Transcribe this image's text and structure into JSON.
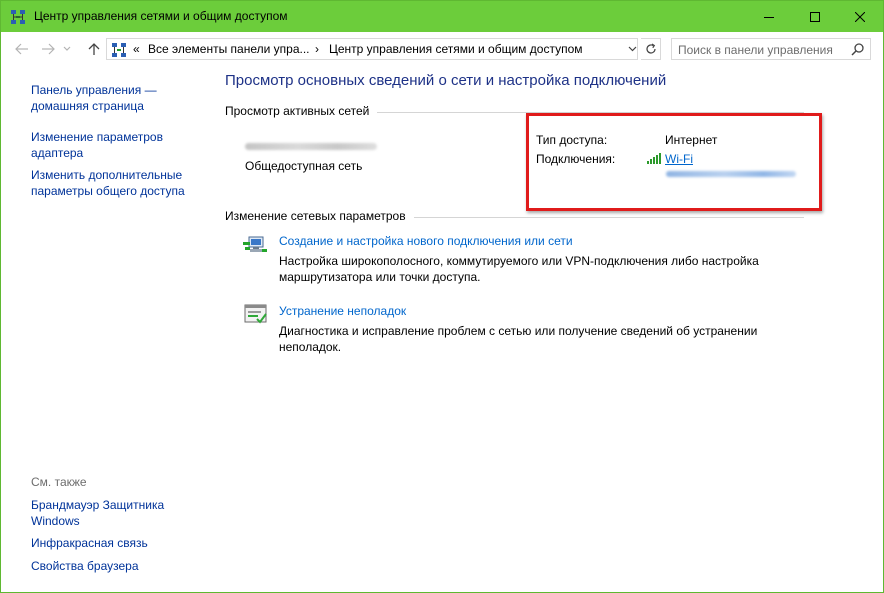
{
  "window": {
    "title": "Центр управления сетями и общим доступом",
    "controls": {
      "minimize": "minimize",
      "maximize": "maximize",
      "close": "close"
    }
  },
  "address": {
    "overflow": "«",
    "crumbs": [
      "Все элементы панели упра...",
      "Центр управления сетями и общим доступом"
    ],
    "separator": "›"
  },
  "search": {
    "placeholder": "Поиск в панели управления"
  },
  "sidebar": {
    "items": [
      {
        "label": "Панель управления — домашняя страница"
      },
      {
        "label": "Изменение параметров адаптера"
      },
      {
        "label": "Изменить дополнительные параметры общего доступа"
      }
    ],
    "see_also": {
      "header": "См. также",
      "items": [
        {
          "label": "Брандмауэр Защитника Windows"
        },
        {
          "label": "Инфракрасная связь"
        },
        {
          "label": "Свойства браузера"
        }
      ]
    }
  },
  "main": {
    "title": "Просмотр основных сведений о сети и настройка подключений",
    "active_networks": {
      "header": "Просмотр активных сетей",
      "network_type": "Общедоступная сеть",
      "access_label": "Тип доступа:",
      "access_value": "Интернет",
      "connections_label": "Подключения:",
      "connection_name": "Wi-Fi"
    },
    "change_settings": {
      "header": "Изменение сетевых параметров",
      "tasks": [
        {
          "title": "Создание и настройка нового подключения или сети",
          "description": "Настройка широкополосного, коммутируемого или VPN-подключения либо настройка маршрутизатора или точки доступа."
        },
        {
          "title": "Устранение неполадок",
          "description": "Диагностика и исправление проблем с сетью или получение сведений об устранении неполадок."
        }
      ]
    }
  },
  "colors": {
    "titlebar": "#6ccd3b",
    "link": "#0066cc",
    "nav_link": "#003399",
    "heading": "#1e3287",
    "highlight": "#e01b1b"
  }
}
